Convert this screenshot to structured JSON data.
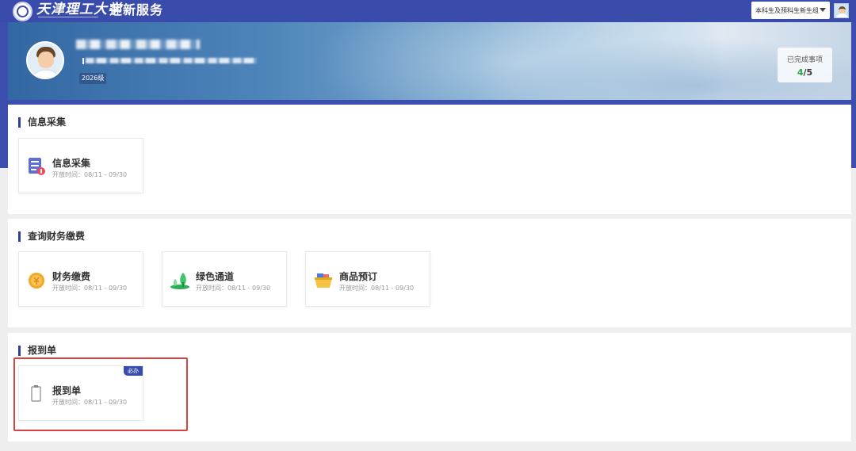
{
  "header": {
    "university_name": "天津理工大学",
    "app_title": "迎新服务",
    "role_select": "本科生及预科生新生组"
  },
  "profile": {
    "grade_tag": "2026级",
    "progress": {
      "label": "已完成事项",
      "done": "4",
      "separator": "/",
      "total": "5"
    }
  },
  "sections": [
    {
      "title": "信息采集",
      "cards": [
        {
          "name": "信息采集",
          "time": "开放时间：08/11 - 09/30",
          "icon": "form-icon"
        }
      ]
    },
    {
      "title": "查询财务缴费",
      "cards": [
        {
          "name": "财务缴费",
          "time": "开放时间：08/11 - 09/30",
          "icon": "coin-icon"
        },
        {
          "name": "绿色通道",
          "time": "开放时间：08/11 - 09/30",
          "icon": "tree-icon"
        },
        {
          "name": "商品预订",
          "time": "开放时间：08/11 - 09/30",
          "icon": "basket-icon"
        }
      ]
    },
    {
      "title": "报到单",
      "cards": [
        {
          "name": "报到单",
          "time": "开放时间：08/11 - 09/30",
          "icon": "clipboard-icon",
          "badge": "必办"
        }
      ]
    }
  ],
  "colors": {
    "primary": "#3a4cab",
    "success": "#29a746",
    "highlight": "#d9433f"
  }
}
